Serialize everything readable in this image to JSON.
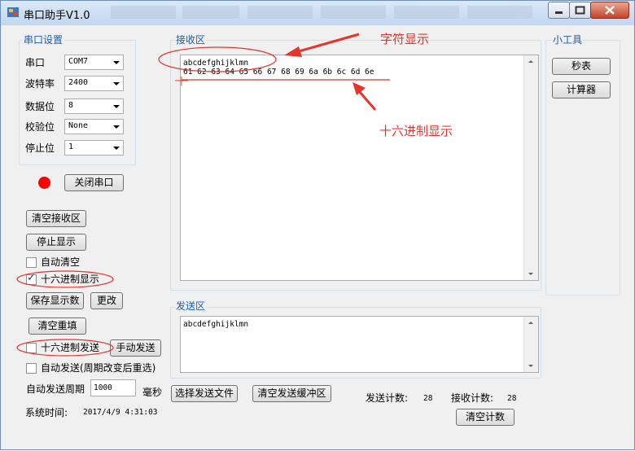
{
  "window": {
    "title": "串口助手V1.0"
  },
  "serial_settings": {
    "group_label": "串口设置",
    "rows": [
      {
        "label": "串口",
        "value": "COM7"
      },
      {
        "label": "波特率",
        "value": "2400"
      },
      {
        "label": "数据位",
        "value": "8"
      },
      {
        "label": "校验位",
        "value": "None"
      },
      {
        "label": "停止位",
        "value": "1"
      }
    ],
    "status_color": "#ff0000",
    "close_port_label": "关闭串口"
  },
  "controls": {
    "clear_receive": "清空接收区",
    "stop_display": "停止显示",
    "auto_clear": "自动清空",
    "hex_display": "十六进制显示",
    "save_display": "保存显示数",
    "change": "更改",
    "clear_refill": "清空重填",
    "hex_send": "十六进制发送",
    "manual_send": "手动发送",
    "auto_send": "自动发送(周期改变后重选)",
    "auto_send_period_label": "自动发送周期",
    "auto_send_period_value": "1000",
    "ms_label": "毫秒",
    "system_time_label": "系统时间:",
    "system_time_value": "2017/4/9 4:31:03"
  },
  "receive": {
    "group_label": "接收区",
    "line1": "abcdefghijklmn",
    "line2": "61 62 63 64 65 66 67 68 69 6a 6b 6c 6d 6e"
  },
  "send": {
    "group_label": "发送区",
    "text": "abcdefghijklmn"
  },
  "toolbar": {
    "select_file": "选择发送文件",
    "clear_send_buffer": "清空发送缓冲区",
    "send_count_label": "发送计数:",
    "send_count": "28",
    "recv_count_label": "接收计数:",
    "recv_count": "28",
    "clear_count": "清空计数"
  },
  "tools": {
    "group_label": "小工具",
    "stopwatch": "秒表",
    "calculator": "计算器"
  },
  "annotations": {
    "char_display": "字符显示",
    "hex_display": "十六进制显示",
    "color": "#e8342b"
  }
}
